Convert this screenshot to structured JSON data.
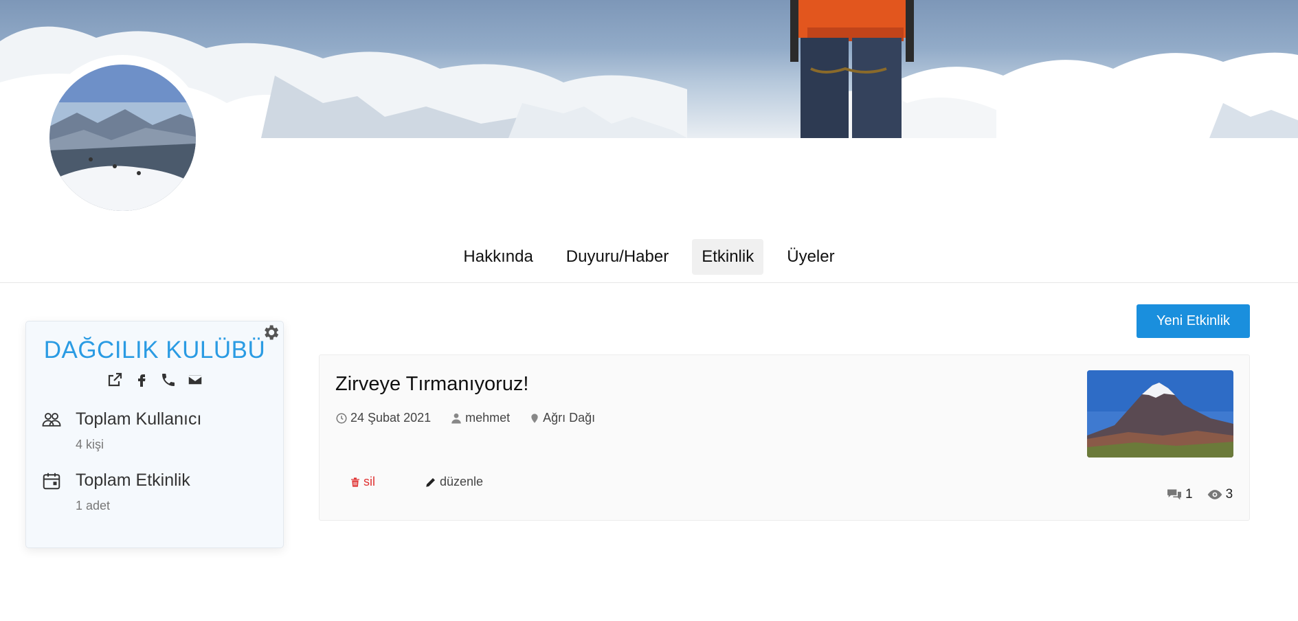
{
  "tabs": [
    {
      "label": "Hakkında",
      "active": false
    },
    {
      "label": "Duyuru/Haber",
      "active": false
    },
    {
      "label": "Etkinlik",
      "active": true
    },
    {
      "label": "Üyeler",
      "active": false
    }
  ],
  "club": {
    "name": "DAĞCILIK KULÜBÜ",
    "social_icons": [
      "external-link-icon",
      "facebook-icon",
      "phone-icon",
      "envelope-icon"
    ],
    "stats": [
      {
        "icon": "users-icon",
        "label": "Toplam Kullanıcı",
        "value": "4 kişi"
      },
      {
        "icon": "calendar-icon",
        "label": "Toplam Etkinlik",
        "value": "1 adet"
      }
    ]
  },
  "new_event_button": "Yeni Etkinlik",
  "event": {
    "title": "Zirveye Tırmanıyoruz!",
    "date": "24 Şubat 2021",
    "author": "mehmet",
    "location": "Ağrı Dağı",
    "delete_label": "sil",
    "edit_label": "düzenle",
    "comments": "1",
    "views": "3"
  },
  "colors": {
    "accent": "#1a8fdd",
    "club_title": "#2a9be3",
    "delete": "#e03333"
  }
}
